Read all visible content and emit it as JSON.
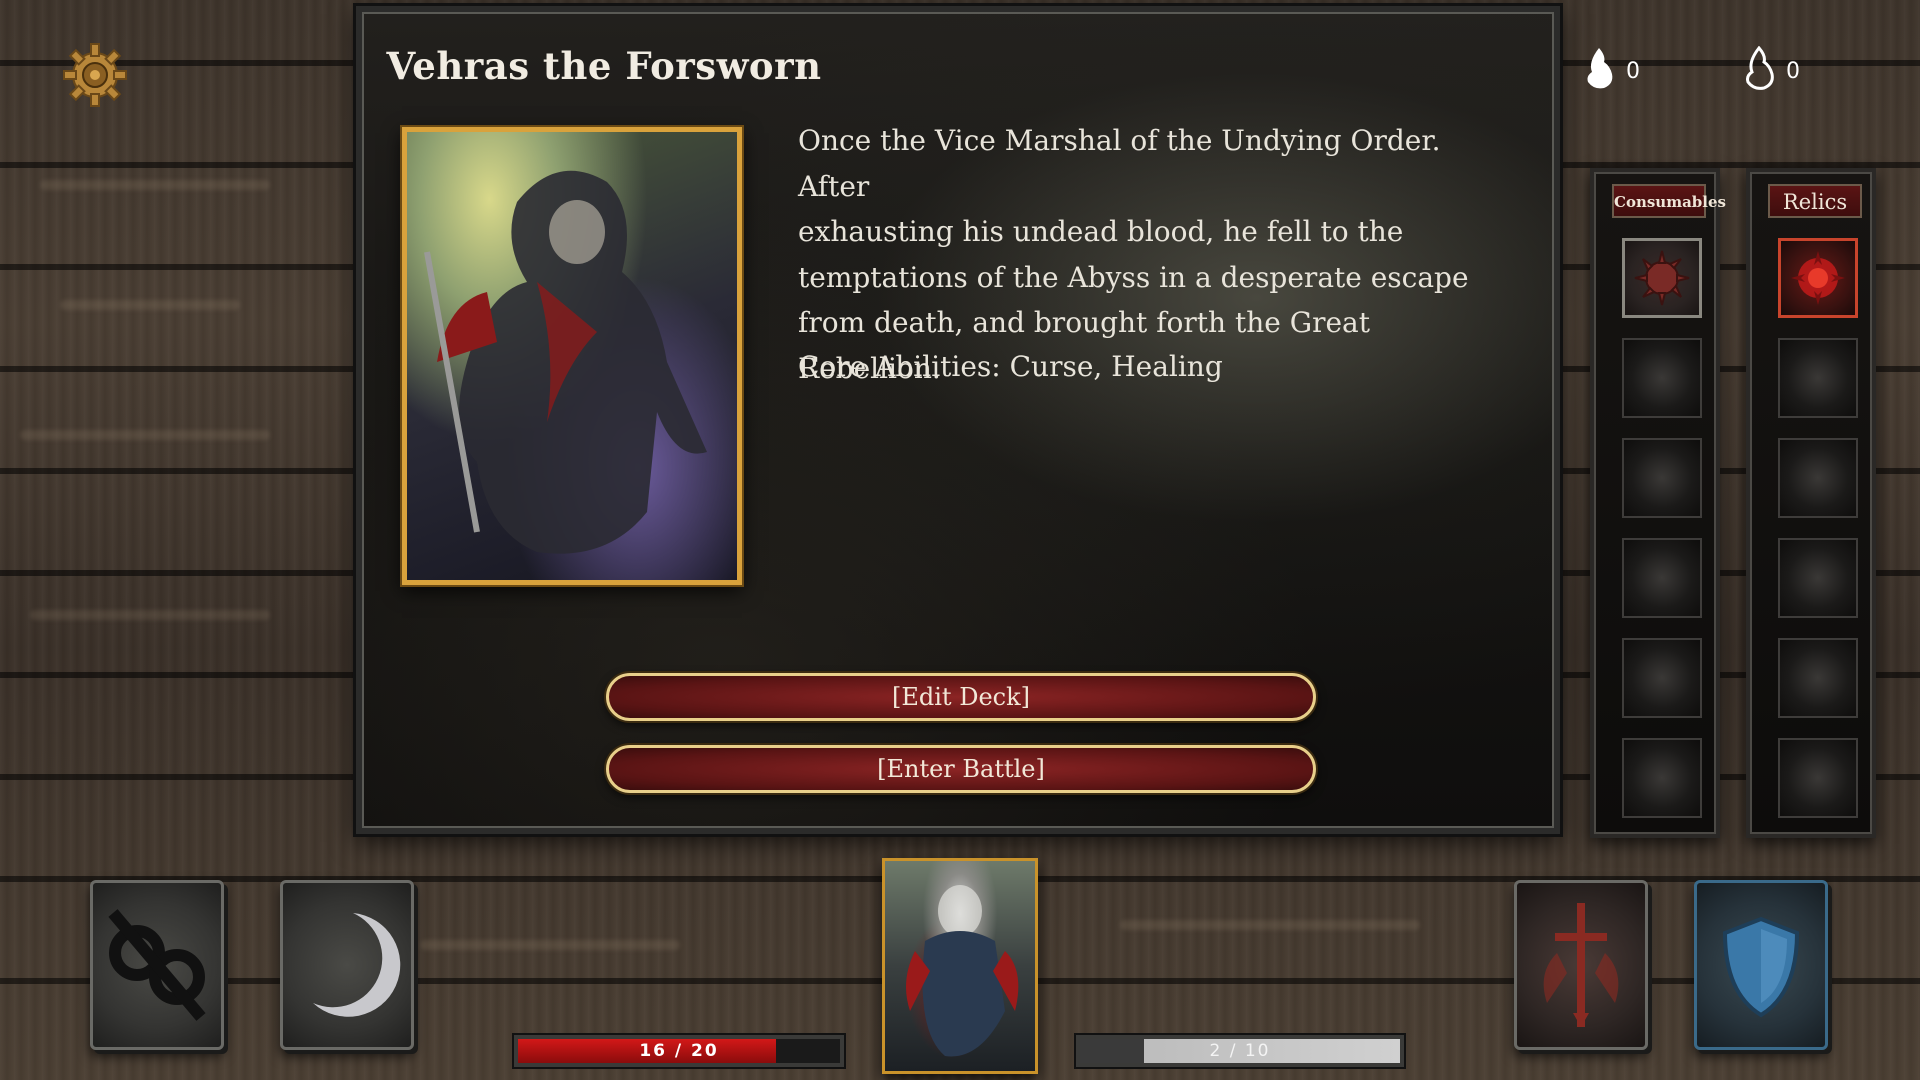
{
  "hero": {
    "name": "Vehras the Forsworn",
    "description": "Once the Vice Marshal of the Undying Order. After\nexhausting his undead blood, he fell to the\ntemptations of the Abyss in a desperate escape\nfrom death, and brought forth the Great Rebellion.",
    "core_abilities": "Core Abilities: Curse, Healing"
  },
  "actions": {
    "edit_deck": "[Edit Deck]",
    "enter_battle": "[Enter Battle]"
  },
  "currencies": [
    {
      "icon": "flame-filled-icon",
      "value": "0"
    },
    {
      "icon": "flame-outline-icon",
      "value": "0"
    }
  ],
  "inventory": {
    "consumables_label": "Consumables",
    "relics_label": "Relics",
    "consumable_slots": [
      "spiked-orb-icon",
      "",
      "",
      "",
      "",
      ""
    ],
    "relic_slots": [
      "blood-orb-icon",
      "",
      "",
      "",
      "",
      ""
    ]
  },
  "bottom_cards": {
    "left": [
      "broken-chain-icon",
      "crescent-moon-icon"
    ],
    "right": [
      "sword-icon",
      "shield-icon"
    ]
  },
  "health": {
    "current": 16,
    "max": 20,
    "text": "16 / 20"
  },
  "experience": {
    "current": 2,
    "max": 10,
    "text": "2 / 10"
  },
  "colors": {
    "accent_gold": "#d9a23c",
    "button_red": "#8c2424",
    "health_red": "#d21818"
  }
}
